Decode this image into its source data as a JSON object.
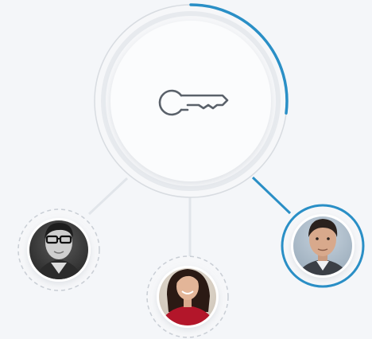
{
  "access_graph": {
    "center": {
      "icon": "key-icon",
      "progress": 0.27
    },
    "members": [
      {
        "icon": "avatar-man-glasses",
        "selected": false
      },
      {
        "icon": "avatar-woman-red-top",
        "selected": false
      },
      {
        "icon": "avatar-man-dark-hair",
        "selected": true
      }
    ],
    "colors": {
      "background": "#f4f6f9",
      "accent": "#2a8fc6",
      "connector": "#dfe3e8",
      "icon_stroke": "#5a616a"
    }
  }
}
